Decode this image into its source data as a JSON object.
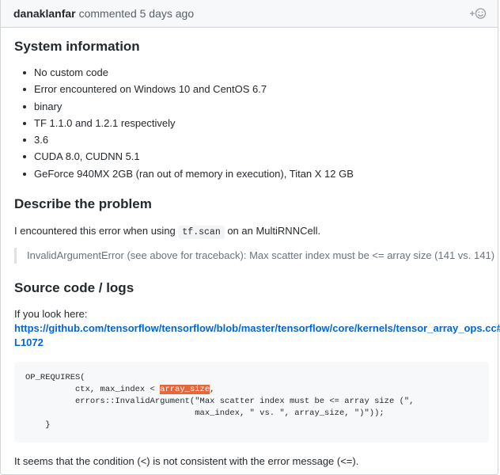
{
  "header": {
    "author": "danaklanfar",
    "meta": "commented 5 days ago"
  },
  "sections": {
    "system_info": {
      "title": "System information",
      "items": [
        "No custom code",
        "Error encountered on Windows 10 and CentOS 6.7",
        "binary",
        "TF 1.1.0 and 1.2.1 respectively",
        "3.6",
        "CUDA 8.0, CUDNN 5.1",
        "GeForce 940MX 2GB (ran out of memory in execution), Titan X 12 GB"
      ]
    },
    "problem": {
      "title": "Describe the problem",
      "text_before": "I encountered this error when using ",
      "code": "tf.scan",
      "text_after": " on an MultiRNNCell.",
      "quote": "InvalidArgumentError (see above for traceback): Max scatter index must be <= array size (141 vs. 141)"
    },
    "source": {
      "title": "Source code / logs",
      "intro": "If you look here:",
      "link_line1": "https://github.com/tensorflow/tensorflow/blob/master/tensorflow/core/kernels/tensor_array_ops.cc#",
      "link_line2": "L1072",
      "code_line1": "OP_REQUIRES(",
      "code_line2_pre": "          ctx, max_index < ",
      "code_line2_hl": "array_size",
      "code_line2_post": ",",
      "code_line3": "          errors::InvalidArgument(\"Max scatter index must be <= array size (\",",
      "code_line4": "                                  max_index, \" vs. \", array_size, \")\"));",
      "code_line5": "    }",
      "conclusion": "It seems that the condition (<) is not consistent with the error message (<=)."
    }
  },
  "icons": {
    "reaction": "add-reaction-icon"
  }
}
